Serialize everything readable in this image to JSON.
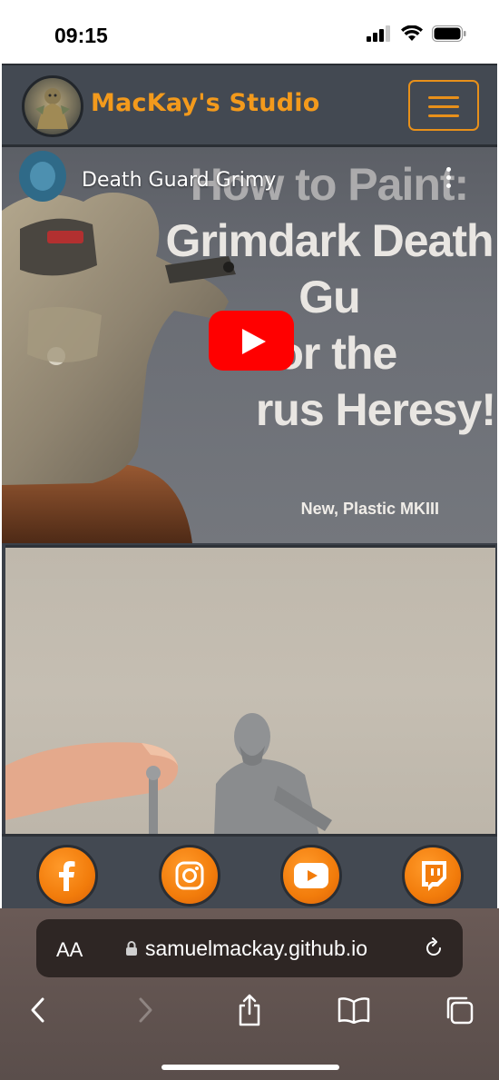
{
  "status_bar": {
    "time": "09:15"
  },
  "navbar": {
    "brand": "MacKay's Studio",
    "menu_icon": "hamburger-icon",
    "accent": "#f39a1c"
  },
  "video": {
    "title": "Death Guard Grimy",
    "thumbnail_text": [
      "How to Paint:",
      "Grimdark Death Gu",
      "for the",
      "rus Heresy!"
    ],
    "thumbnail_subtext": "New, Plastic MKIII",
    "play_color": "#ff0000"
  },
  "footer": {
    "socials": [
      {
        "name": "facebook-icon"
      },
      {
        "name": "instagram-icon"
      },
      {
        "name": "youtube-icon"
      },
      {
        "name": "twitch-icon"
      }
    ],
    "accent": "#f27c0b"
  },
  "browser": {
    "text_size_label": "AA",
    "url": "samuelmackay.github.io"
  }
}
